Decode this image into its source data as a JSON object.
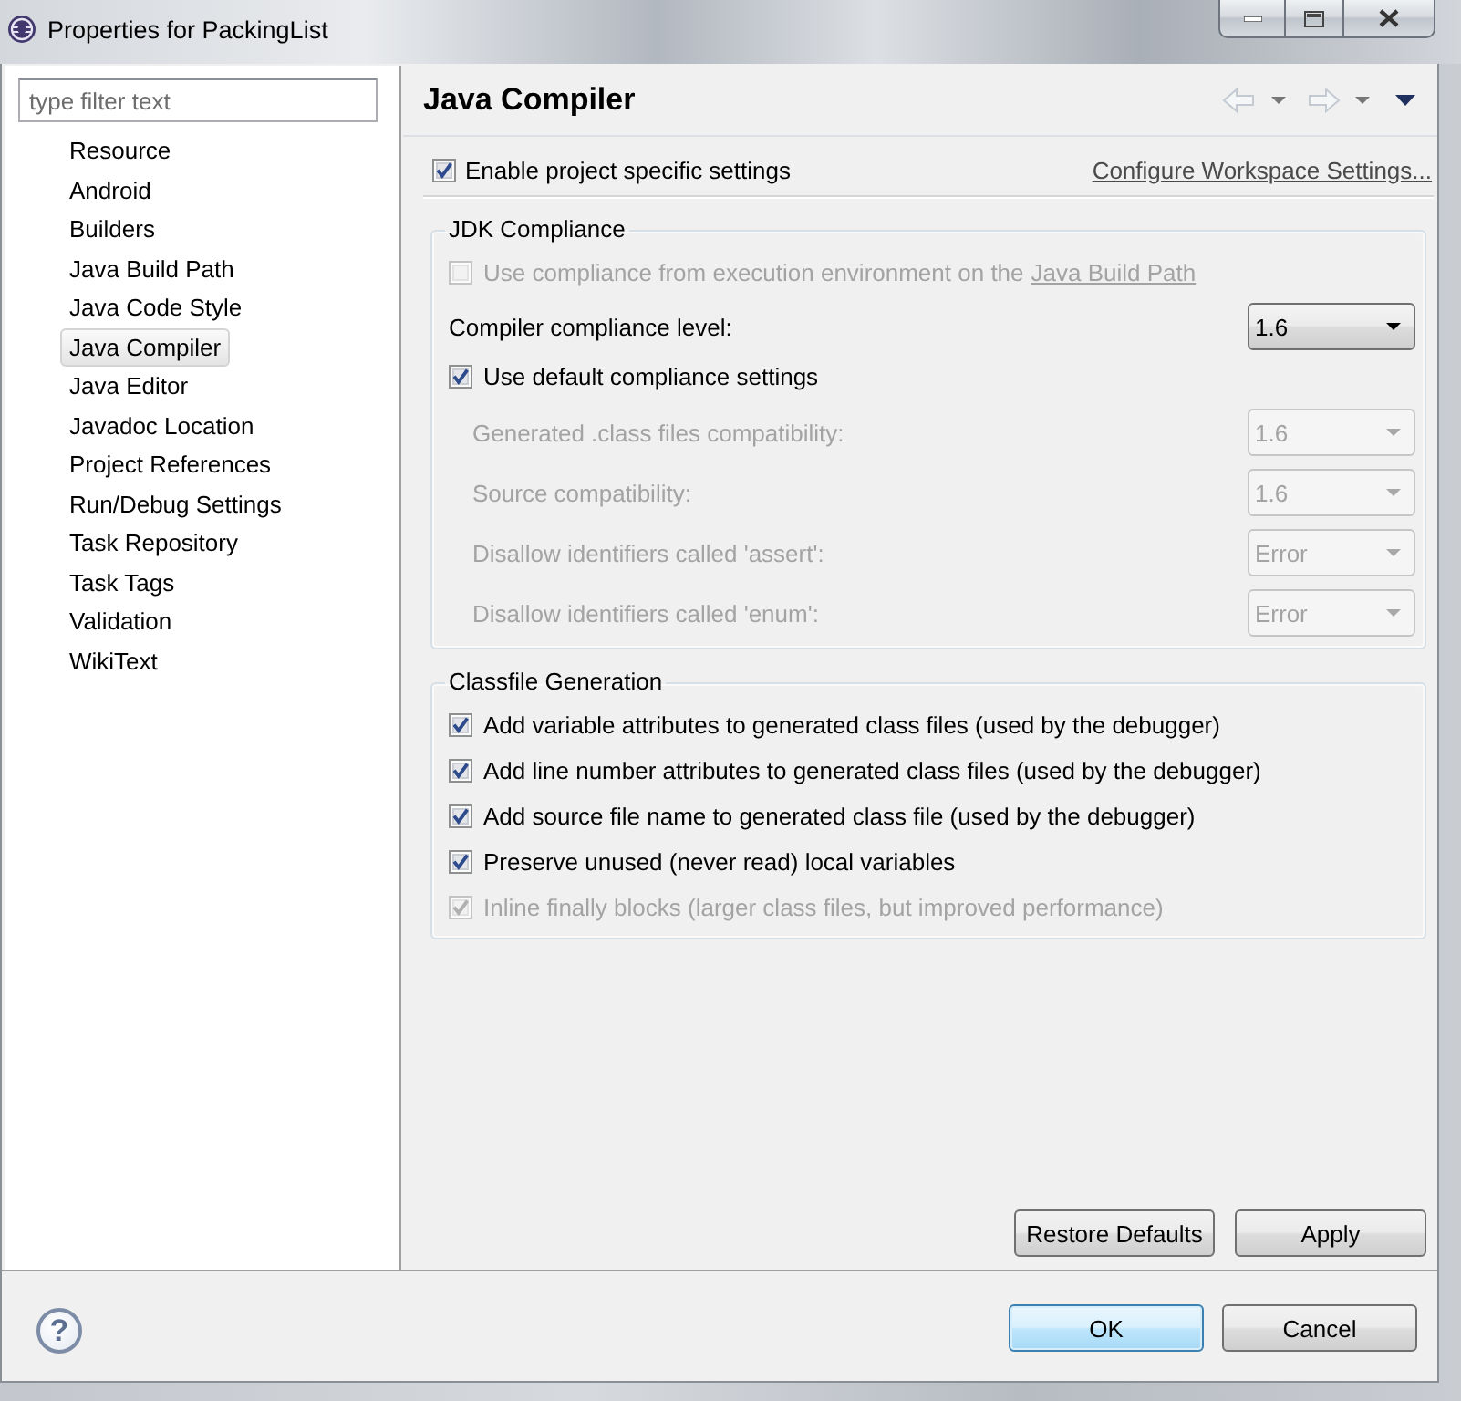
{
  "window": {
    "title": "Properties for PackingList"
  },
  "sidebar": {
    "filter": {
      "placeholder": "type filter text"
    },
    "items": [
      {
        "label": "Resource",
        "selected": false
      },
      {
        "label": "Android",
        "selected": false
      },
      {
        "label": "Builders",
        "selected": false
      },
      {
        "label": "Java Build Path",
        "selected": false
      },
      {
        "label": "Java Code Style",
        "selected": false
      },
      {
        "label": "Java Compiler",
        "selected": true
      },
      {
        "label": "Java Editor",
        "selected": false
      },
      {
        "label": "Javadoc Location",
        "selected": false
      },
      {
        "label": "Project References",
        "selected": false
      },
      {
        "label": "Run/Debug Settings",
        "selected": false
      },
      {
        "label": "Task Repository",
        "selected": false
      },
      {
        "label": "Task Tags",
        "selected": false
      },
      {
        "label": "Validation",
        "selected": false
      },
      {
        "label": "WikiText",
        "selected": false
      }
    ]
  },
  "page": {
    "title": "Java Compiler",
    "project_settings": {
      "label": "Enable project specific settings",
      "checked": true
    },
    "workspace_link": "Configure Workspace Settings...",
    "groups": [
      {
        "title": "JDK Compliance",
        "rows": [
          {
            "kind": "checkbox",
            "label": "Use compliance from execution environment on the",
            "link": "Java Build Path",
            "checked": false,
            "disabled": true
          },
          {
            "kind": "dropdown",
            "label": "Compiler compliance level:",
            "value": "1.6",
            "disabled": false
          },
          {
            "kind": "checkbox",
            "label": "Use default compliance settings",
            "checked": true,
            "disabled": false,
            "children": [
              {
                "kind": "dropdown",
                "label": "Generated .class files compatibility:",
                "value": "1.6",
                "disabled": true
              },
              {
                "kind": "dropdown",
                "label": "Source compatibility:",
                "value": "1.6",
                "disabled": true
              },
              {
                "kind": "dropdown",
                "label": "Disallow identifiers called 'assert':",
                "value": "Error",
                "disabled": true
              },
              {
                "kind": "dropdown",
                "label": "Disallow identifiers called 'enum':",
                "value": "Error",
                "disabled": true
              }
            ]
          }
        ]
      },
      {
        "title": "Classfile Generation",
        "rows": [
          {
            "kind": "checkbox",
            "label": "Add variable attributes to generated class files (used by the debugger)",
            "checked": true,
            "disabled": false
          },
          {
            "kind": "checkbox",
            "label": "Add line number attributes to generated class files (used by the debugger)",
            "checked": true,
            "disabled": false
          },
          {
            "kind": "checkbox",
            "label": "Add source file name to generated class file (used by the debugger)",
            "checked": true,
            "disabled": false
          },
          {
            "kind": "checkbox",
            "label": "Preserve unused (never read) local variables",
            "checked": true,
            "disabled": false
          },
          {
            "kind": "checkbox",
            "label": "Inline finally blocks (larger class files, but improved performance)",
            "checked": true,
            "disabled": true
          }
        ]
      }
    ],
    "buttons": [
      "Restore Defaults",
      "Apply"
    ]
  },
  "footer": {
    "help": "?",
    "buttons": [
      {
        "label": "OK",
        "default": true
      },
      {
        "label": "Cancel",
        "default": false
      }
    ]
  }
}
